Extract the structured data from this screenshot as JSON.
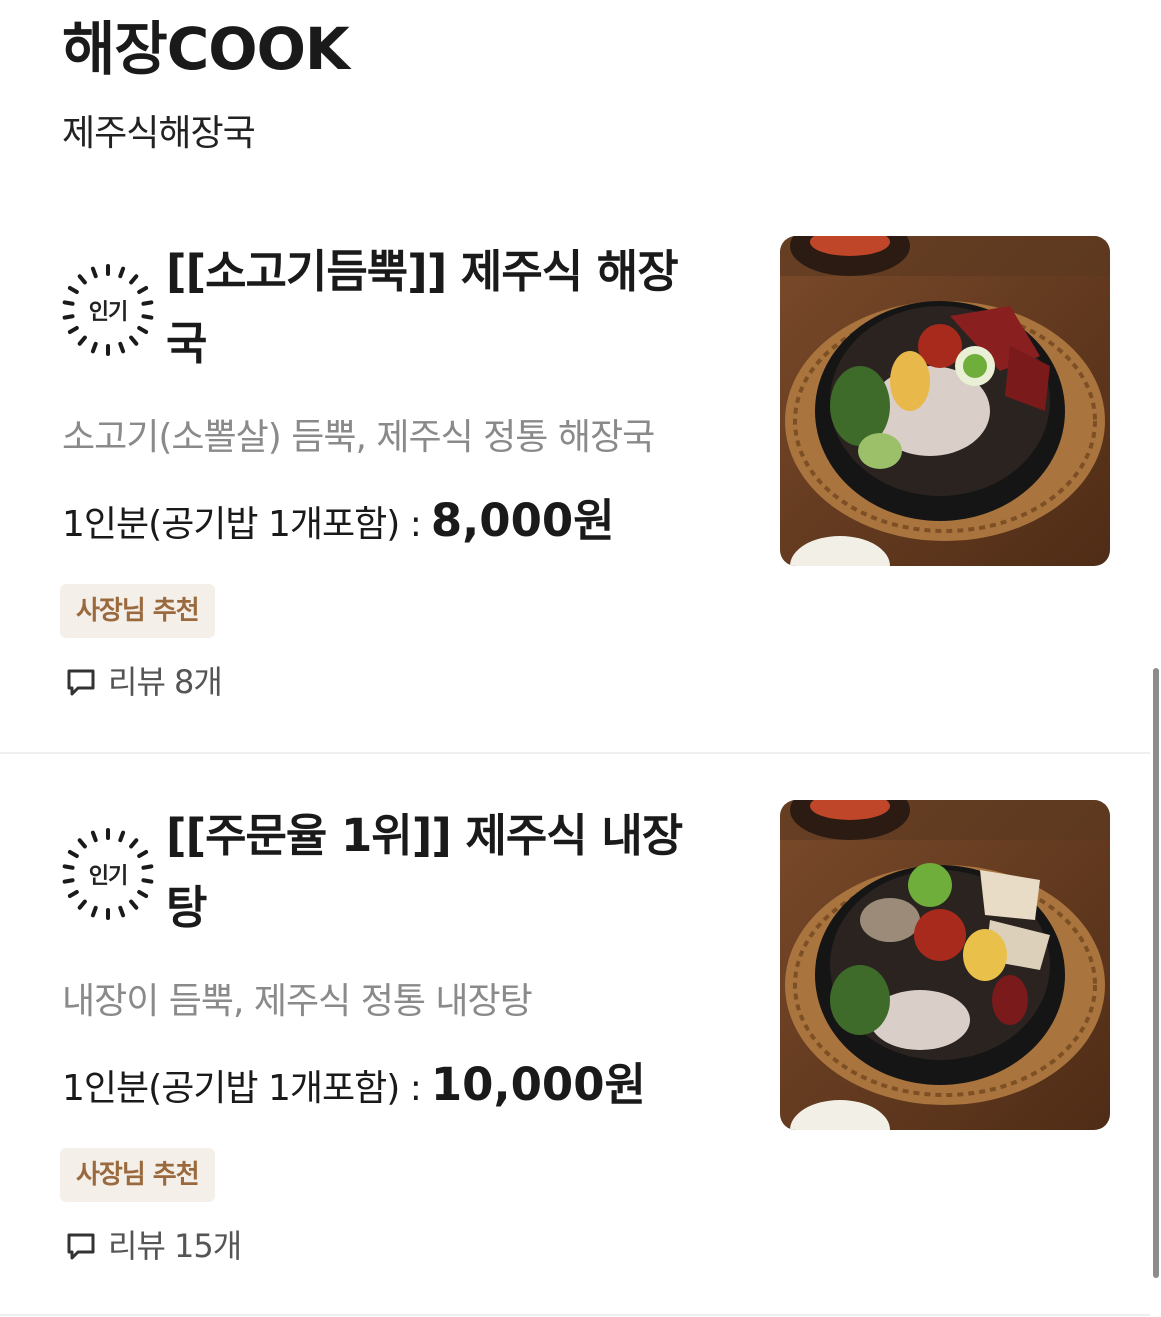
{
  "shop": {
    "title": "해장COOK",
    "subtitle": "제주식해장국"
  },
  "menu": [
    {
      "badge": "인기",
      "title_line1": "[[소고기듬뿍]] 제주식 해장",
      "title_line2": "국",
      "description": "소고기(소뽈살) 듬뿍, 제주식 정통 해장국",
      "price_label": "1인분(공기밥 1개포함) :",
      "price": "8,000원",
      "tag": "사장님 추천",
      "review": "리뷰 8개",
      "image_icon": "beef-haejangguk-photo"
    },
    {
      "badge": "인기",
      "title_line1": "[[주문율 1위]]  제주식 내장",
      "title_line2": "탕",
      "description": "내장이 듬뿍, 제주식 정통 내장탕",
      "price_label": "1인분(공기밥 1개포함) :",
      "price": "10,000원",
      "tag": "사장님 추천",
      "review": "리뷰 15개",
      "image_icon": "naejangtang-photo"
    }
  ],
  "colors": {
    "tag_bg": "#f4efe9",
    "tag_text": "#9a6a3e",
    "desc_text": "#8a8a8a"
  }
}
